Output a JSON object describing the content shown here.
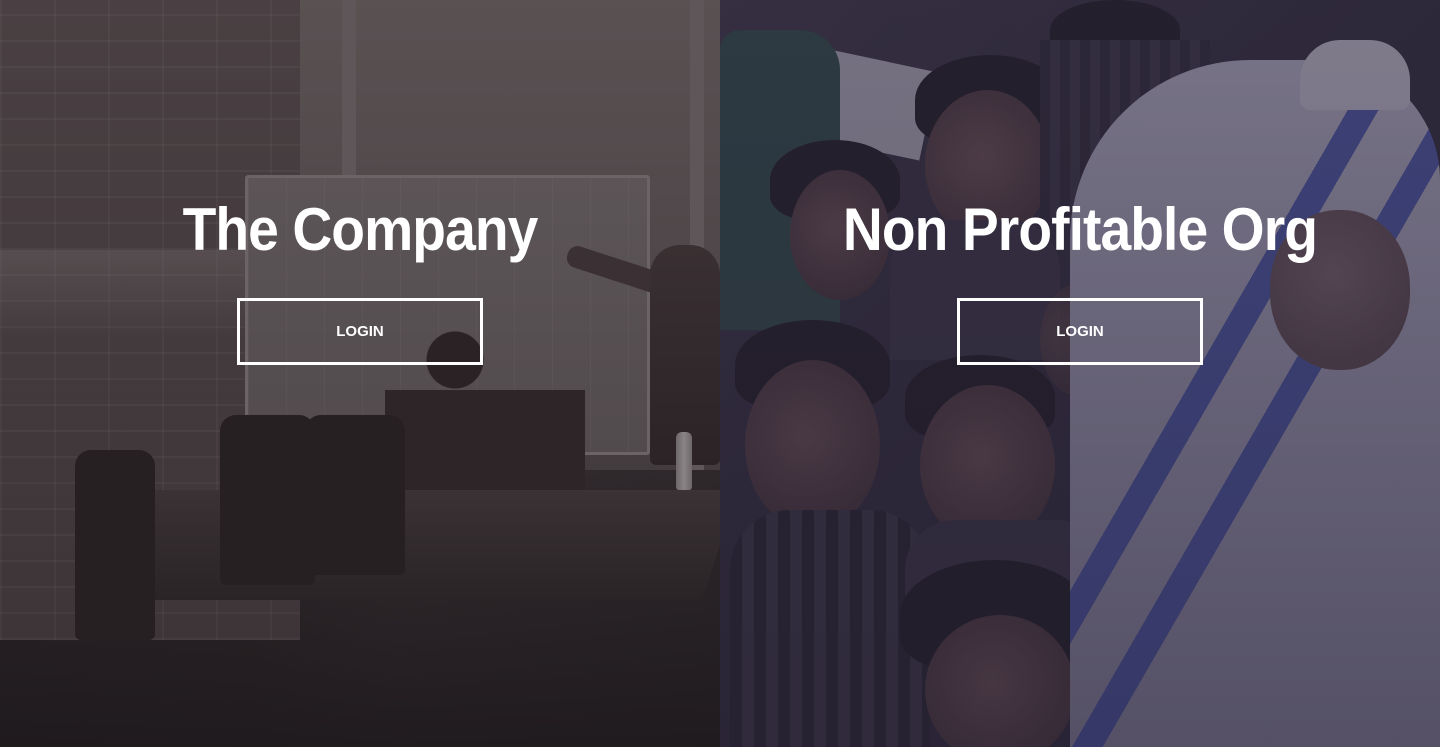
{
  "panels": [
    {
      "title": "The Company",
      "button_label": "LOGIN",
      "background": "office-meeting-photo",
      "overlay_color": "#2a2226"
    },
    {
      "title": "Non Profitable Org",
      "button_label": "LOGIN",
      "background": "children-with-nun-photo",
      "overlay_color": "#2b2638"
    }
  ],
  "colors": {
    "text": "#ffffff",
    "button_border": "#ffffff"
  }
}
